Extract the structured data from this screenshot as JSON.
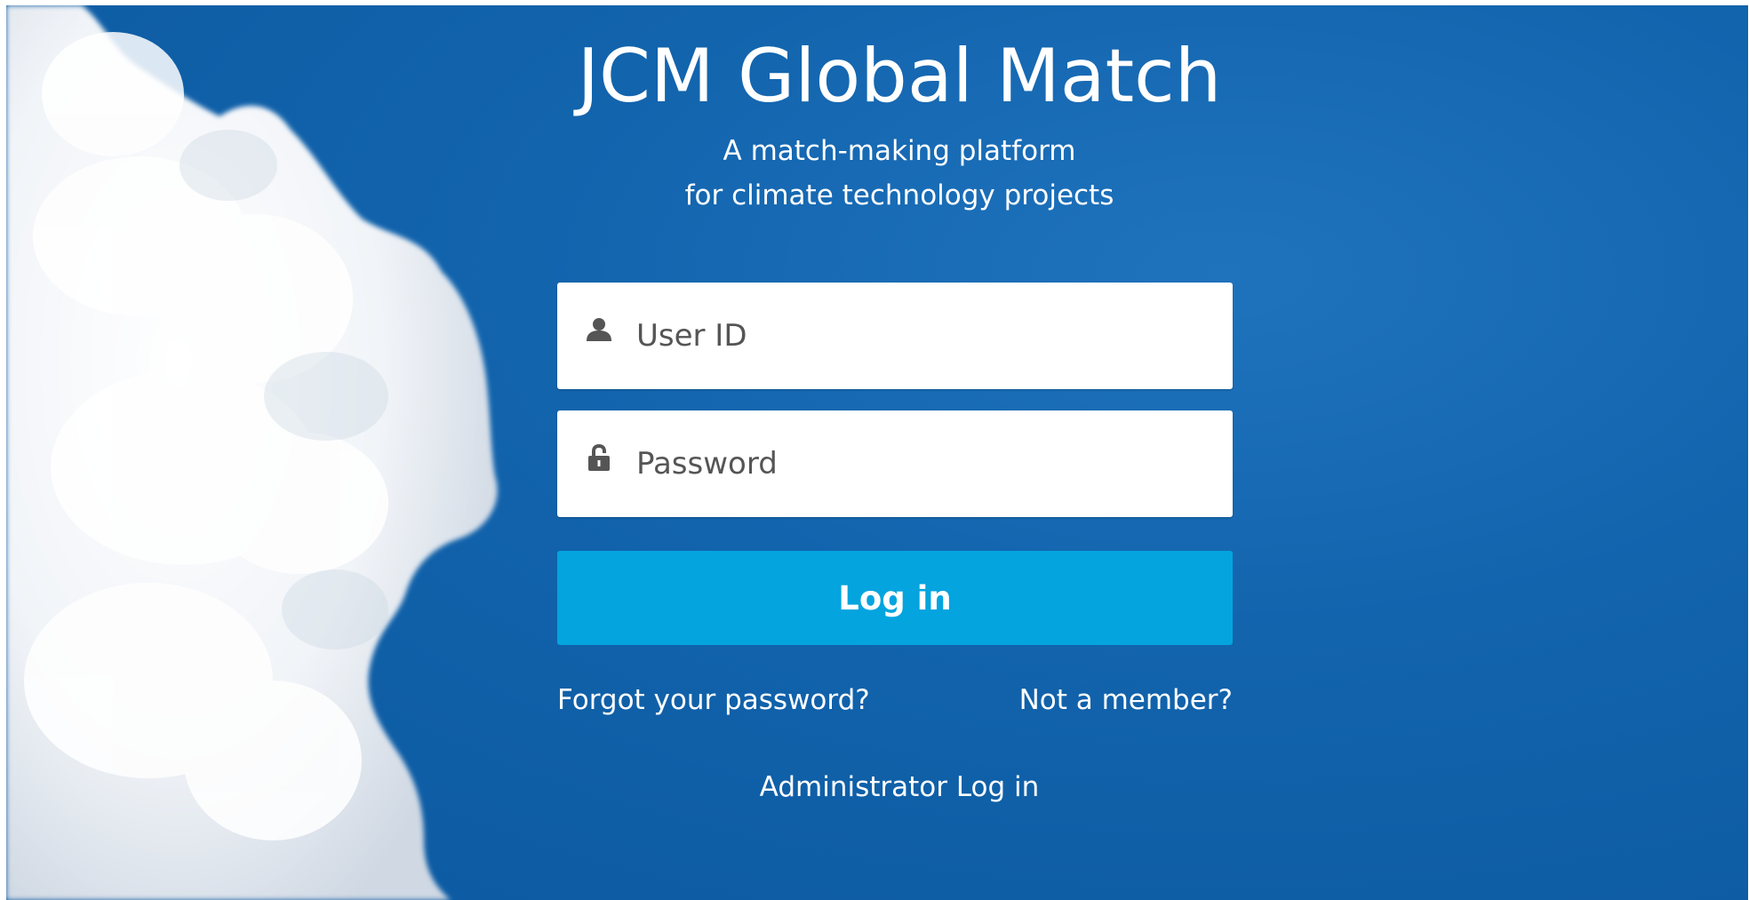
{
  "app": {
    "title": "JCM Global Match",
    "subtitle_line1": "A match-making platform",
    "subtitle_line2": "for climate technology projects"
  },
  "form": {
    "user_id": {
      "placeholder": "User ID",
      "value": "",
      "icon": "user-icon"
    },
    "password": {
      "placeholder": "Password",
      "value": "",
      "icon": "lock-icon"
    },
    "login_label": "Log in"
  },
  "links": {
    "forgot_password": "Forgot your password?",
    "not_member": "Not a member?",
    "admin_login": "Administrator Log in"
  },
  "colors": {
    "background_blue": "#1264ad",
    "button_blue": "#04a4df",
    "text_white": "#ffffff"
  },
  "decor": {
    "background_image": "cloud"
  }
}
